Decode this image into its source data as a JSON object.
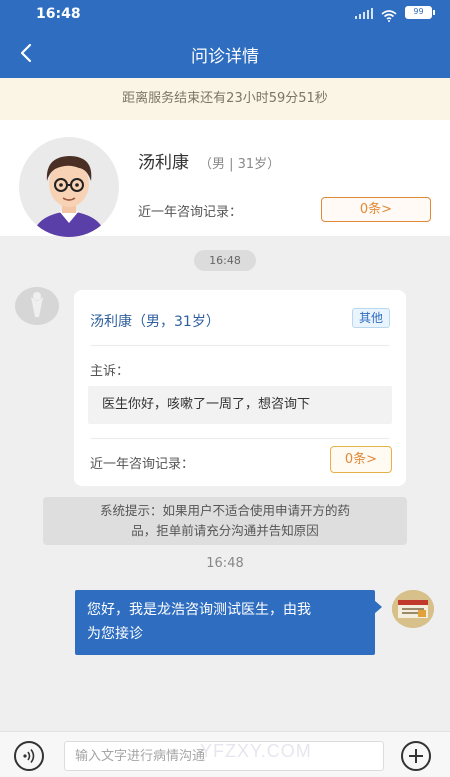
{
  "status_bar": {
    "time": "16:48",
    "battery": "99",
    "icons": [
      "signal-icon",
      "wifi-icon",
      "battery-icon"
    ]
  },
  "nav": {
    "back_icon": "chevron-left-icon",
    "title": "问诊详情"
  },
  "countdown": "距离服务结束还有23小时59分51秒",
  "patient": {
    "name": "汤利康",
    "meta": "（男 | 31岁）",
    "record_label": "近一年咨询记录：",
    "record_button": "0条>"
  },
  "chat": {
    "time1": "16:48",
    "inquiry": {
      "name": "汤利康（男，31岁）",
      "tag": "其他",
      "complaint_label": "主诉：",
      "complaint": "医生你好，咳嗽了一周了，想咨询下",
      "record_label": "近一年咨询记录：",
      "record_button": "0条>"
    },
    "system_tip_line1": "系统提示：如果用户不适合使用申请开方的药",
    "system_tip_line2": "品，拒单前请充分沟通并告知原因",
    "time2": "16:48",
    "doctor_message_line1": "您好，我是龙浩咨询测试医生，由我",
    "doctor_message_line2": "为您接诊"
  },
  "input_bar": {
    "voice_icon": "voice-icon",
    "placeholder": "输入文字进行病情沟通",
    "plus_icon": "plus-circle-icon",
    "watermark": "YFZXY.COM"
  },
  "colors": {
    "primary": "#2f6dc0",
    "accent_orange": "#e08a38",
    "banner_bg": "#fbf5e5"
  }
}
